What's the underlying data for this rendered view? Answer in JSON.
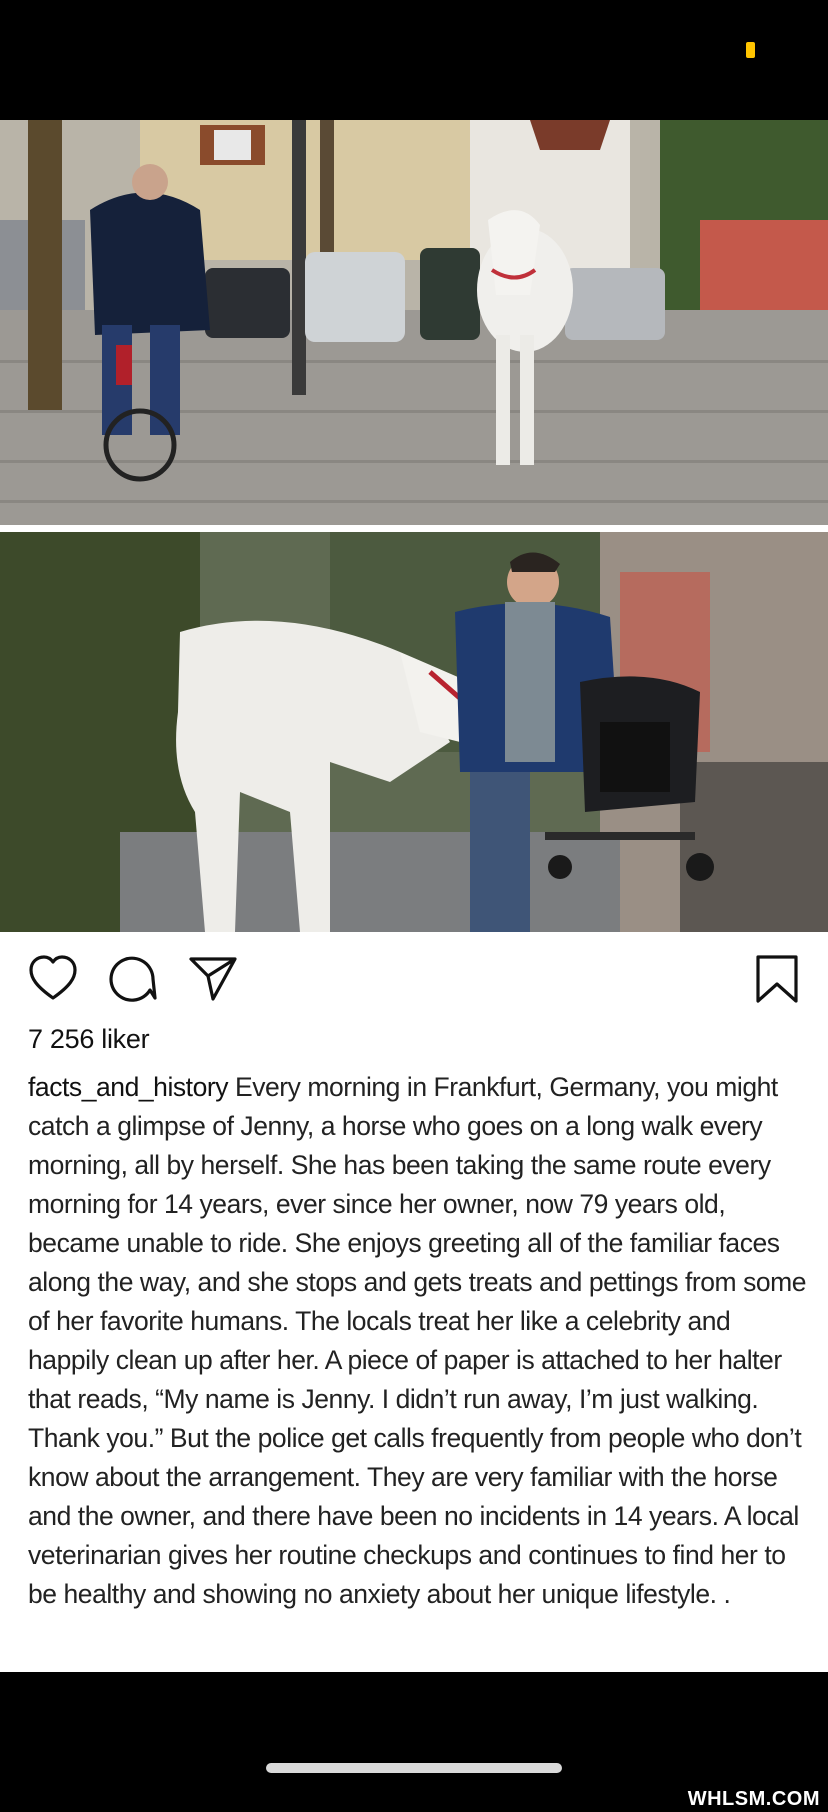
{
  "post": {
    "likes": "7 256 liker",
    "username": "facts_and_history",
    "caption": "Every morning in Frankfurt, Germany, you might catch a glimpse of Jenny, a horse who goes on a long walk every morning, all by herself. She has been taking the same route every morning for 14 years, ever since her owner, now 79 years old, became unable to ride. She enjoys greeting all of the familiar faces along the way, and she stops and gets treats and pettings from some of her favorite humans. The locals treat her like a celebrity and happily clean up after her. A piece of paper is attached to her halter that reads, “My name is Jenny. I didn’t run away, I’m just walking. Thank you.” But the police get calls frequently from people who don’t know about the arrangement. They are very familiar with the horse and the owner, and there have been no incidents in 14 years. A local veterinarian gives her routine checkups and continues to find her to be healthy and showing no anxiety about her unique lifestyle. ."
  },
  "icons": {
    "like": "heart-outline-icon",
    "comment": "speech-bubble-icon",
    "share": "paper-plane-icon",
    "save": "bookmark-outline-icon"
  },
  "watermark": "WHLSM.COM",
  "colors": {
    "battery": "#ffc400",
    "background": "#000000",
    "post_bg": "#ffffff"
  }
}
